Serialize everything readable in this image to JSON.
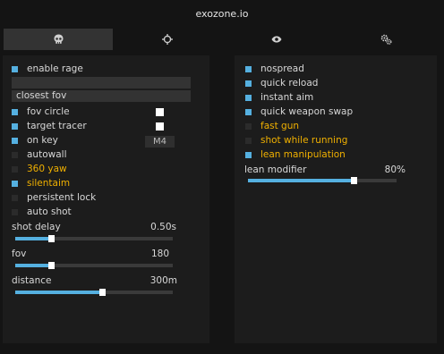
{
  "app": {
    "title": "exozone.io"
  },
  "tabs": [
    {
      "name": "skull"
    },
    {
      "name": "crosshair"
    },
    {
      "name": "eye"
    },
    {
      "name": "settings"
    }
  ],
  "left": {
    "enable_rage": {
      "label": "enable rage",
      "checked": true
    },
    "select_empty": {
      "value": ""
    },
    "select_target": {
      "value": "closest fov"
    },
    "fov_circle": {
      "label": "fov circle",
      "checked": true
    },
    "target_tracer": {
      "label": "target tracer",
      "checked": true
    },
    "on_key": {
      "label": "on key",
      "checked": true,
      "key": "M4"
    },
    "autowall": {
      "label": "autowall",
      "checked": false
    },
    "yaw360": {
      "label": "360 yaw",
      "checked": false
    },
    "silentaim": {
      "label": "silentaim",
      "checked": true
    },
    "persistent_lock": {
      "label": "persistent lock",
      "checked": false
    },
    "auto_shot": {
      "label": "auto shot",
      "checked": false
    },
    "shot_delay": {
      "label": "shot delay",
      "value": "0.50s",
      "fraction": 0.23
    },
    "fov": {
      "label": "fov",
      "value": "180",
      "fraction": 0.23
    },
    "distance": {
      "label": "distance",
      "value": "300m",
      "fraction": 0.55
    }
  },
  "right": {
    "nospread": {
      "label": "nospread",
      "checked": true
    },
    "quick_reload": {
      "label": "quick reload",
      "checked": true
    },
    "instant_aim": {
      "label": "instant aim",
      "checked": true
    },
    "quick_weapon_swap": {
      "label": "quick weapon swap",
      "checked": true
    },
    "fast_gun": {
      "label": "fast gun",
      "checked": false
    },
    "shot_while_running": {
      "label": "shot while running",
      "checked": false
    },
    "lean_manipulation": {
      "label": "lean manipulation",
      "checked": true
    },
    "lean_modifier": {
      "label": "lean modifier",
      "value": "80%",
      "fraction": 0.71
    }
  },
  "colors": {
    "accent": "#55b0e0",
    "warning": "#f0b000",
    "panel": "#1c1c1c",
    "background": "#141414"
  }
}
